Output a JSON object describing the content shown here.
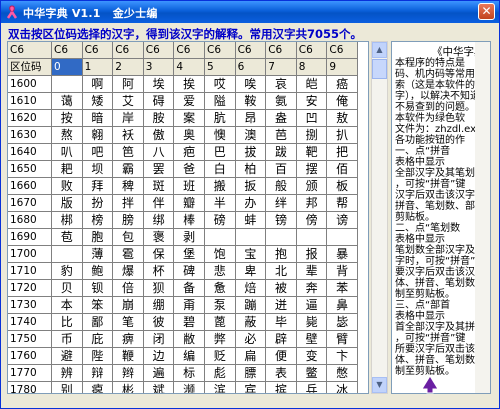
{
  "window": {
    "title": "中华字典 V1.1   金少士编",
    "close_glyph": "✕"
  },
  "instruction": "双击按区位码选择的汉字，得到该汉字的解释。常用汉字共7055个。",
  "grid": {
    "row_header_top": "C6",
    "row_header_sub": "区位码",
    "col_prefix": [
      "C6",
      "C6",
      "C6",
      "C6",
      "C6",
      "C6",
      "C6",
      "C6",
      "C6",
      "C6"
    ],
    "col_digits": [
      "0",
      "1",
      "2",
      "3",
      "4",
      "5",
      "6",
      "7",
      "8",
      "9"
    ],
    "selected_col": 0,
    "rows": [
      {
        "code": "1600",
        "chars": [
          "",
          "啊",
          "阿",
          "埃",
          "挨",
          "哎",
          "唉",
          "哀",
          "皑",
          "癌"
        ]
      },
      {
        "code": "1610",
        "chars": [
          "蔼",
          "矮",
          "艾",
          "碍",
          "爱",
          "隘",
          "鞍",
          "氨",
          "安",
          "俺"
        ]
      },
      {
        "code": "1620",
        "chars": [
          "按",
          "暗",
          "岸",
          "胺",
          "案",
          "肮",
          "昂",
          "盎",
          "凹",
          "敖"
        ]
      },
      {
        "code": "1630",
        "chars": [
          "熬",
          "翱",
          "袄",
          "傲",
          "奥",
          "懊",
          "澳",
          "芭",
          "捌",
          "扒"
        ]
      },
      {
        "code": "1640",
        "chars": [
          "叭",
          "吧",
          "笆",
          "八",
          "疤",
          "巴",
          "拔",
          "跋",
          "靶",
          "把"
        ]
      },
      {
        "code": "1650",
        "chars": [
          "耙",
          "坝",
          "霸",
          "罢",
          "爸",
          "白",
          "柏",
          "百",
          "摆",
          "佰"
        ]
      },
      {
        "code": "1660",
        "chars": [
          "败",
          "拜",
          "稗",
          "斑",
          "班",
          "搬",
          "扳",
          "般",
          "颁",
          "板"
        ]
      },
      {
        "code": "1670",
        "chars": [
          "版",
          "扮",
          "拌",
          "伴",
          "瓣",
          "半",
          "办",
          "绊",
          "邦",
          "帮"
        ]
      },
      {
        "code": "1680",
        "chars": [
          "梆",
          "榜",
          "膀",
          "绑",
          "棒",
          "磅",
          "蚌",
          "镑",
          "傍",
          "谤"
        ]
      },
      {
        "code": "1690",
        "chars": [
          "苞",
          "胞",
          "包",
          "褒",
          "剥",
          "",
          "",
          "",
          "",
          ""
        ]
      },
      {
        "code": "1700",
        "chars": [
          "",
          "薄",
          "雹",
          "保",
          "堡",
          "饱",
          "宝",
          "抱",
          "报",
          "暴"
        ]
      },
      {
        "code": "1710",
        "chars": [
          "豹",
          "鲍",
          "爆",
          "杯",
          "碑",
          "悲",
          "卑",
          "北",
          "辈",
          "背"
        ]
      },
      {
        "code": "1720",
        "chars": [
          "贝",
          "钡",
          "倍",
          "狈",
          "备",
          "惫",
          "焙",
          "被",
          "奔",
          "苯"
        ]
      },
      {
        "code": "1730",
        "chars": [
          "本",
          "笨",
          "崩",
          "绷",
          "甭",
          "泵",
          "蹦",
          "迸",
          "逼",
          "鼻"
        ]
      },
      {
        "code": "1740",
        "chars": [
          "比",
          "鄙",
          "笔",
          "彼",
          "碧",
          "蓖",
          "蔽",
          "毕",
          "毙",
          "毖"
        ]
      },
      {
        "code": "1750",
        "chars": [
          "币",
          "庇",
          "痹",
          "闭",
          "敝",
          "弊",
          "必",
          "辟",
          "壁",
          "臂"
        ]
      },
      {
        "code": "1760",
        "chars": [
          "避",
          "陛",
          "鞭",
          "边",
          "编",
          "贬",
          "扁",
          "便",
          "变",
          "卞"
        ]
      },
      {
        "code": "1770",
        "chars": [
          "辨",
          "辩",
          "辫",
          "遍",
          "标",
          "彪",
          "膘",
          "表",
          "鳖",
          "憋"
        ]
      },
      {
        "code": "1780",
        "chars": [
          "别",
          "瘪",
          "彬",
          "斌",
          "濒",
          "滨",
          "宾",
          "摈",
          "兵",
          "冰"
        ]
      }
    ]
  },
  "help": {
    "title": "《中华字典",
    "lines": [
      "   本程序的特点是",
      "码、机内码等常用字",
      "索（这是本软件的最",
      "字），以解决不知道",
      "不易查到的问题。",
      "   本软件为绿色软",
      "文件为：zhzdl.exe",
      "   各功能按钮的作",
      "    一、点“拼音",
      "        表格中显示",
      "全部汉字及其笔划",
      "，可按“拼音”键",
      "汉字后双击该汉字，",
      "拼音、笔划数、部首",
      "剪贴板。",
      "    二、点“笔划数",
      "        表格中显示",
      "笔划数全部汉字及其",
      "字时，可按“拼音”",
      "要汉字后双击该汉字",
      "体、拼音、笔划数、部",
      "制至剪贴板。",
      "    三、点“部首",
      "        表格中显示",
      "首全部汉字及其拼音",
      "，可按“拼音”键",
      "所要汉字后双击该汉字",
      "体、拼音、笔划数、",
      "制至剪贴板。"
    ]
  },
  "colors": {
    "instruction": "#0000c8",
    "selection": "#316ac5",
    "titlebar": "#0a5fd9"
  },
  "icons": {
    "app": "pink-ribbon-icon",
    "close": "close-icon",
    "scroll_up": "arrow-up-icon",
    "scroll_down": "arrow-down-icon",
    "cursor": "mouse-cursor-icon"
  }
}
